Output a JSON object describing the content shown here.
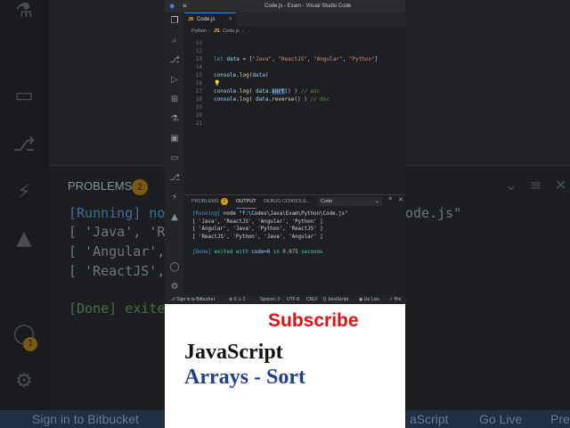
{
  "background": {
    "panel_label": "PROBLEMS",
    "panel_badge": "2",
    "line1": "[Running] noo",
    "line1_suffix": "ode.js\"",
    "line2": "[ 'Java', 'Re",
    "line3": "[ 'Angular',",
    "line4": "[ 'ReactJS',",
    "line5": "[Done] exited",
    "status_left": "Sign in to Bitbucket",
    "status_right1": "aScript",
    "status_right2": "Go Live",
    "status_right3": "Pre",
    "badge_value": "1"
  },
  "window": {
    "title": "Code.js - Exam - Visual Studio Code",
    "tab_label": "Code.js",
    "tab_icon": "JS",
    "breadcrumb_folder": "Python",
    "breadcrumb_icon": "JS",
    "breadcrumb_file": "Code.js"
  },
  "editor": {
    "line_numbers": [
      "11",
      "12",
      "13",
      "14",
      "15",
      "16",
      "17",
      "18",
      "19",
      "20",
      "21"
    ]
  },
  "panel": {
    "tabs": {
      "problems": "PROBLEMS",
      "problems_count": "2",
      "output": "OUTPUT",
      "debug": "DEBUG CONSOLE",
      "terminal_dots": "…"
    },
    "dropdown_value": "Code",
    "output_lines": {
      "running_tag": "[Running]",
      "running_cmd": " node \"f:\\Codes\\Java\\Exam\\Python\\Code.js\"",
      "l1": "[ 'Java', 'ReactJS', 'Angular', 'Python' ]",
      "l2": "[ 'Angular', 'Java', 'Python', 'ReactJS' ]",
      "l3": "[ 'ReactJS', 'Python', 'Java', 'Angular' ]",
      "done_tag": "[Done]",
      "done_a": " exited with ",
      "done_code": "code=0",
      "done_b": " in ",
      "done_time": "0.075",
      "done_c": " seconds"
    }
  },
  "statusbar": {
    "sign_in": "Sign in to Bitbucket",
    "errors": "⊗ 0 ⚠ 2",
    "spaces": "Spaces: 2",
    "encoding": "UTF-8",
    "eol": "CRLF",
    "language": "{} JavaScript",
    "golive": "Go Live",
    "prettier": "✓ Pre"
  },
  "overlay": {
    "subscribe": "Subscribe",
    "heading1": "JavaScript",
    "heading2": "Arrays - Sort"
  },
  "colors": {
    "accent": "#3b82f6",
    "subscribe": "#e21010",
    "heading2": "#1e3f8a"
  }
}
